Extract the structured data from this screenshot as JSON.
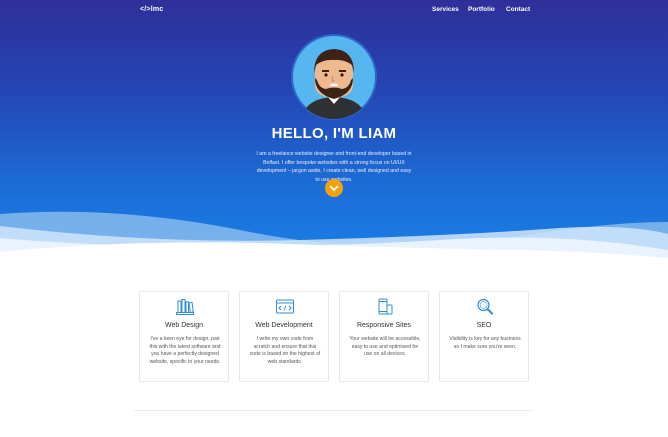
{
  "brand": {
    "logo": "</>lmc"
  },
  "nav": {
    "services": "Services",
    "portfolio": "Portfolio",
    "contact": "Contact"
  },
  "hero": {
    "title": "HELLO, I'M LIAM",
    "intro": "I am a freelance website designer and front-end developer based in Belfast. I offer bespoke websites with a strong focus on UI/UX development – jargon aside, I create clean, well designed and easy to use websites."
  },
  "colors": {
    "accent": "#f2a20f",
    "icon": "#2e8fd6",
    "hero_top": "#2e2f9a",
    "hero_bottom": "#1a80e6"
  },
  "services": [
    {
      "icon": "books-icon",
      "title": "Web Design",
      "desc": "I've a keen eye for design, pair this with the latest software and you have a perfectly designed website, specific to your needs."
    },
    {
      "icon": "code-window-icon",
      "title": "Web Development",
      "desc": "I write my own code from scratch and ensure that this code is based on the highest of web standards."
    },
    {
      "icon": "mobile-tablet-icon",
      "title": "Responsive Sites",
      "desc": "Your website will be accessible, easy to use and optimised for use on all devices."
    },
    {
      "icon": "magnifier-icon",
      "title": "SEO",
      "desc": "Visibility is key for any business so I make sure you're seen."
    }
  ]
}
